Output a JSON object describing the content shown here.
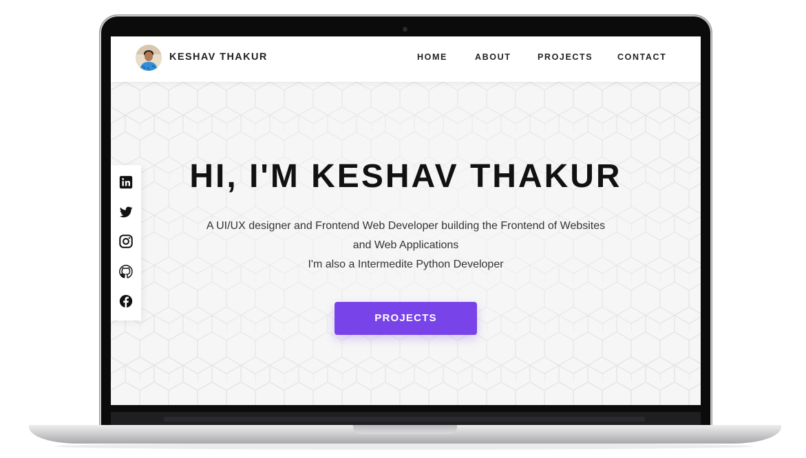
{
  "nav": {
    "brand": "KESHAV THAKUR",
    "links": [
      {
        "label": "HOME"
      },
      {
        "label": "ABOUT"
      },
      {
        "label": "PROJECTS"
      },
      {
        "label": "CONTACT"
      }
    ]
  },
  "hero": {
    "title": "HI, I'M KESHAV THAKUR",
    "lines": [
      "A UI/UX designer and Frontend Web Developer building the Frontend of Websites",
      "and Web Applications",
      "I'm also a Intermedite Python Developer"
    ],
    "cta_label": "PROJECTS"
  },
  "social": [
    {
      "icon": "linkedin-icon"
    },
    {
      "icon": "twitter-icon"
    },
    {
      "icon": "instagram-icon"
    },
    {
      "icon": "github-icon"
    },
    {
      "icon": "facebook-icon"
    }
  ],
  "colors": {
    "accent": "#7843e9",
    "text_dark": "#111111",
    "background": "#f6f6f6"
  }
}
